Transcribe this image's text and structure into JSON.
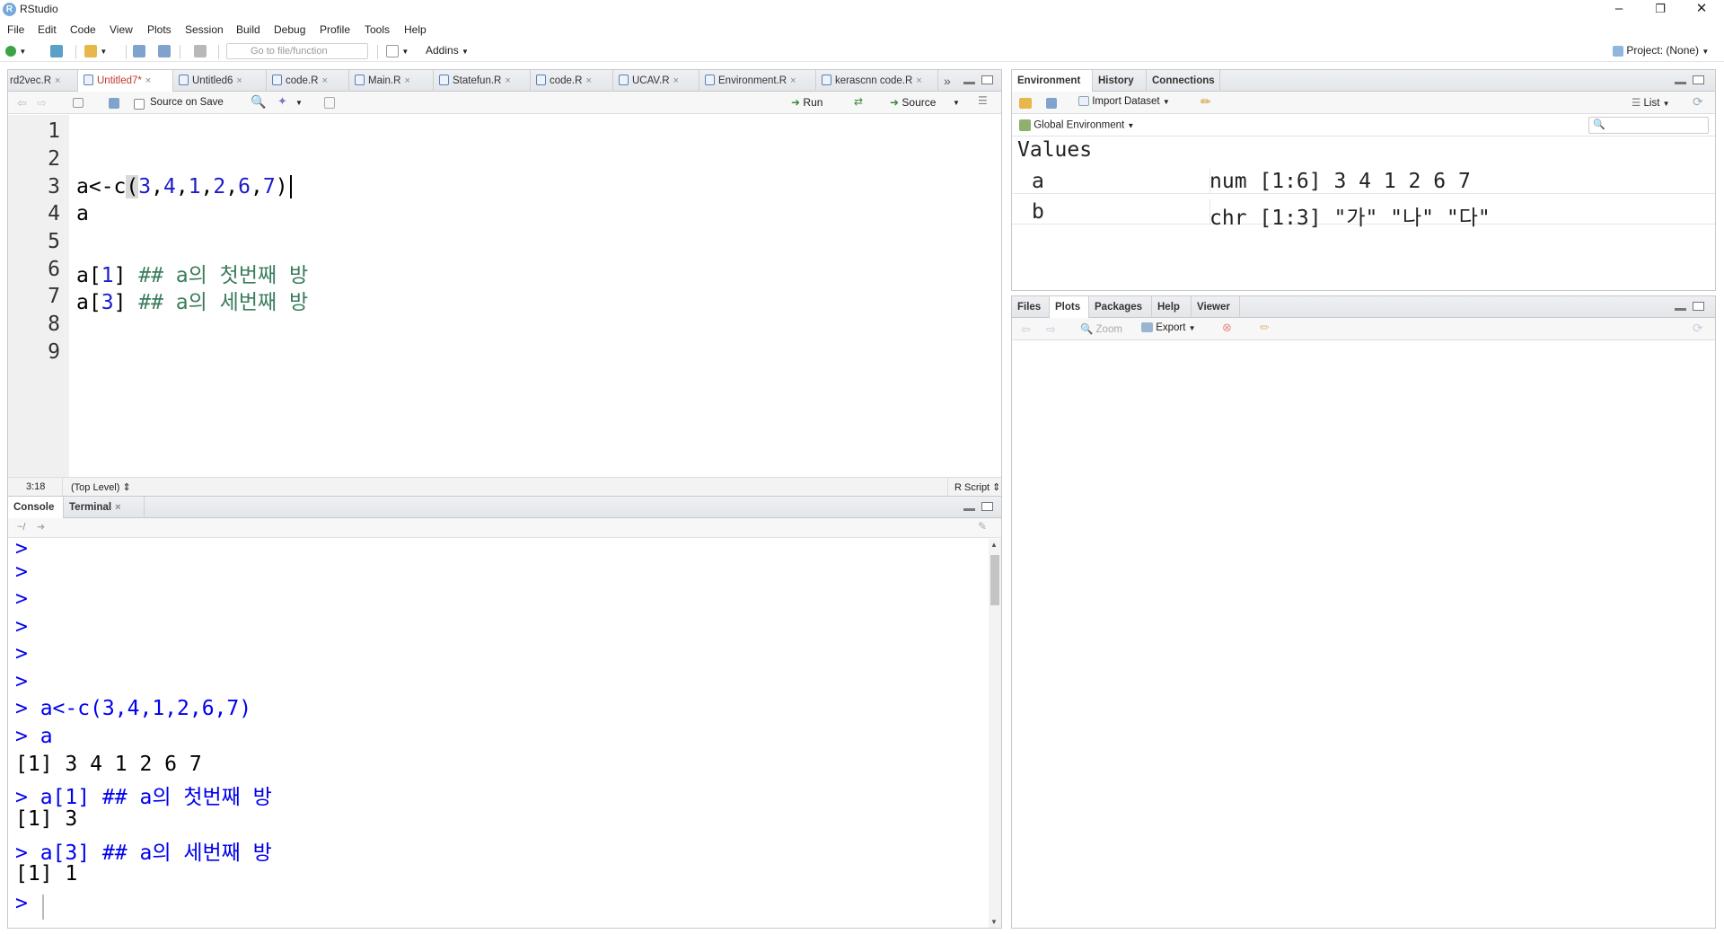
{
  "window": {
    "title": "RStudio"
  },
  "menu": [
    "File",
    "Edit",
    "Code",
    "View",
    "Plots",
    "Session",
    "Build",
    "Debug",
    "Profile",
    "Tools",
    "Help"
  ],
  "toolbar": {
    "goto_placeholder": "Go to file/function",
    "addins": "Addins",
    "project": "Project: (None)"
  },
  "editor": {
    "tabs": [
      "rd2vec.R",
      "Untitled7*",
      "Untitled6",
      "code.R",
      "Main.R",
      "Statefun.R",
      "code.R",
      "UCAV.R",
      "Environment.R",
      "kerascnn code.R"
    ],
    "active_tab": "Untitled7*",
    "source_on_save": "Source on Save",
    "run": "Run",
    "source": "Source",
    "line_numbers": [
      "1",
      "2",
      "3",
      "4",
      "5",
      "6",
      "7",
      "8",
      "9"
    ],
    "lines": {
      "l3a": "a<-c",
      "l3b": "(",
      "l3c": "3",
      "l3d": ",",
      "l3e": "4",
      "l3f": ",",
      "l3g": "1",
      "l3h": ",",
      "l3i": "2",
      "l3j": ",",
      "l3k": "6",
      "l3l": ",",
      "l3m": "7",
      "l3n": ")",
      "l4": "a",
      "l6a": "a[",
      "l6b": "1",
      "l6c": "] ",
      "l6d": "## a의 첫번째 방",
      "l7a": "a[",
      "l7b": "3",
      "l7c": "] ",
      "l7d": "## a의 세번째 방"
    },
    "status_pos": "3:18",
    "status_scope": "(Top Level)",
    "status_type": "R Script"
  },
  "console": {
    "tabs": [
      "Console",
      "Terminal"
    ],
    "path": "~/",
    "lines": [
      {
        "kind": "prompt",
        "text": ">"
      },
      {
        "kind": "prompt",
        "text": ">"
      },
      {
        "kind": "prompt",
        "text": ">"
      },
      {
        "kind": "prompt",
        "text": ">"
      },
      {
        "kind": "prompt",
        "text": ">"
      },
      {
        "kind": "prompt",
        "text": ">"
      },
      {
        "kind": "input",
        "text": "> a<-c(3,4,1,2,6,7)"
      },
      {
        "kind": "input",
        "text": "> a"
      },
      {
        "kind": "output",
        "text": "[1] 3 4 1 2 6 7"
      },
      {
        "kind": "input",
        "text": "> a[1] ## a의 첫번째 방"
      },
      {
        "kind": "output",
        "text": "[1] 3"
      },
      {
        "kind": "input",
        "text": "> a[3] ## a의 세번째 방"
      },
      {
        "kind": "output",
        "text": "[1] 1"
      },
      {
        "kind": "prompt",
        "text": ">"
      }
    ]
  },
  "environment": {
    "tabs": [
      "Environment",
      "History",
      "Connections"
    ],
    "import_dataset": "Import Dataset",
    "view_mode": "List",
    "scope": "Global Environment",
    "section": "Values",
    "rows": [
      {
        "name": "a",
        "value": "num [1:6] 3 4 1 2 6 7"
      },
      {
        "name": "b",
        "value": "chr [1:3] \"가\" \"나\" \"다\""
      }
    ]
  },
  "files": {
    "tabs": [
      "Files",
      "Plots",
      "Packages",
      "Help",
      "Viewer"
    ],
    "zoom": "Zoom",
    "export": "Export"
  }
}
